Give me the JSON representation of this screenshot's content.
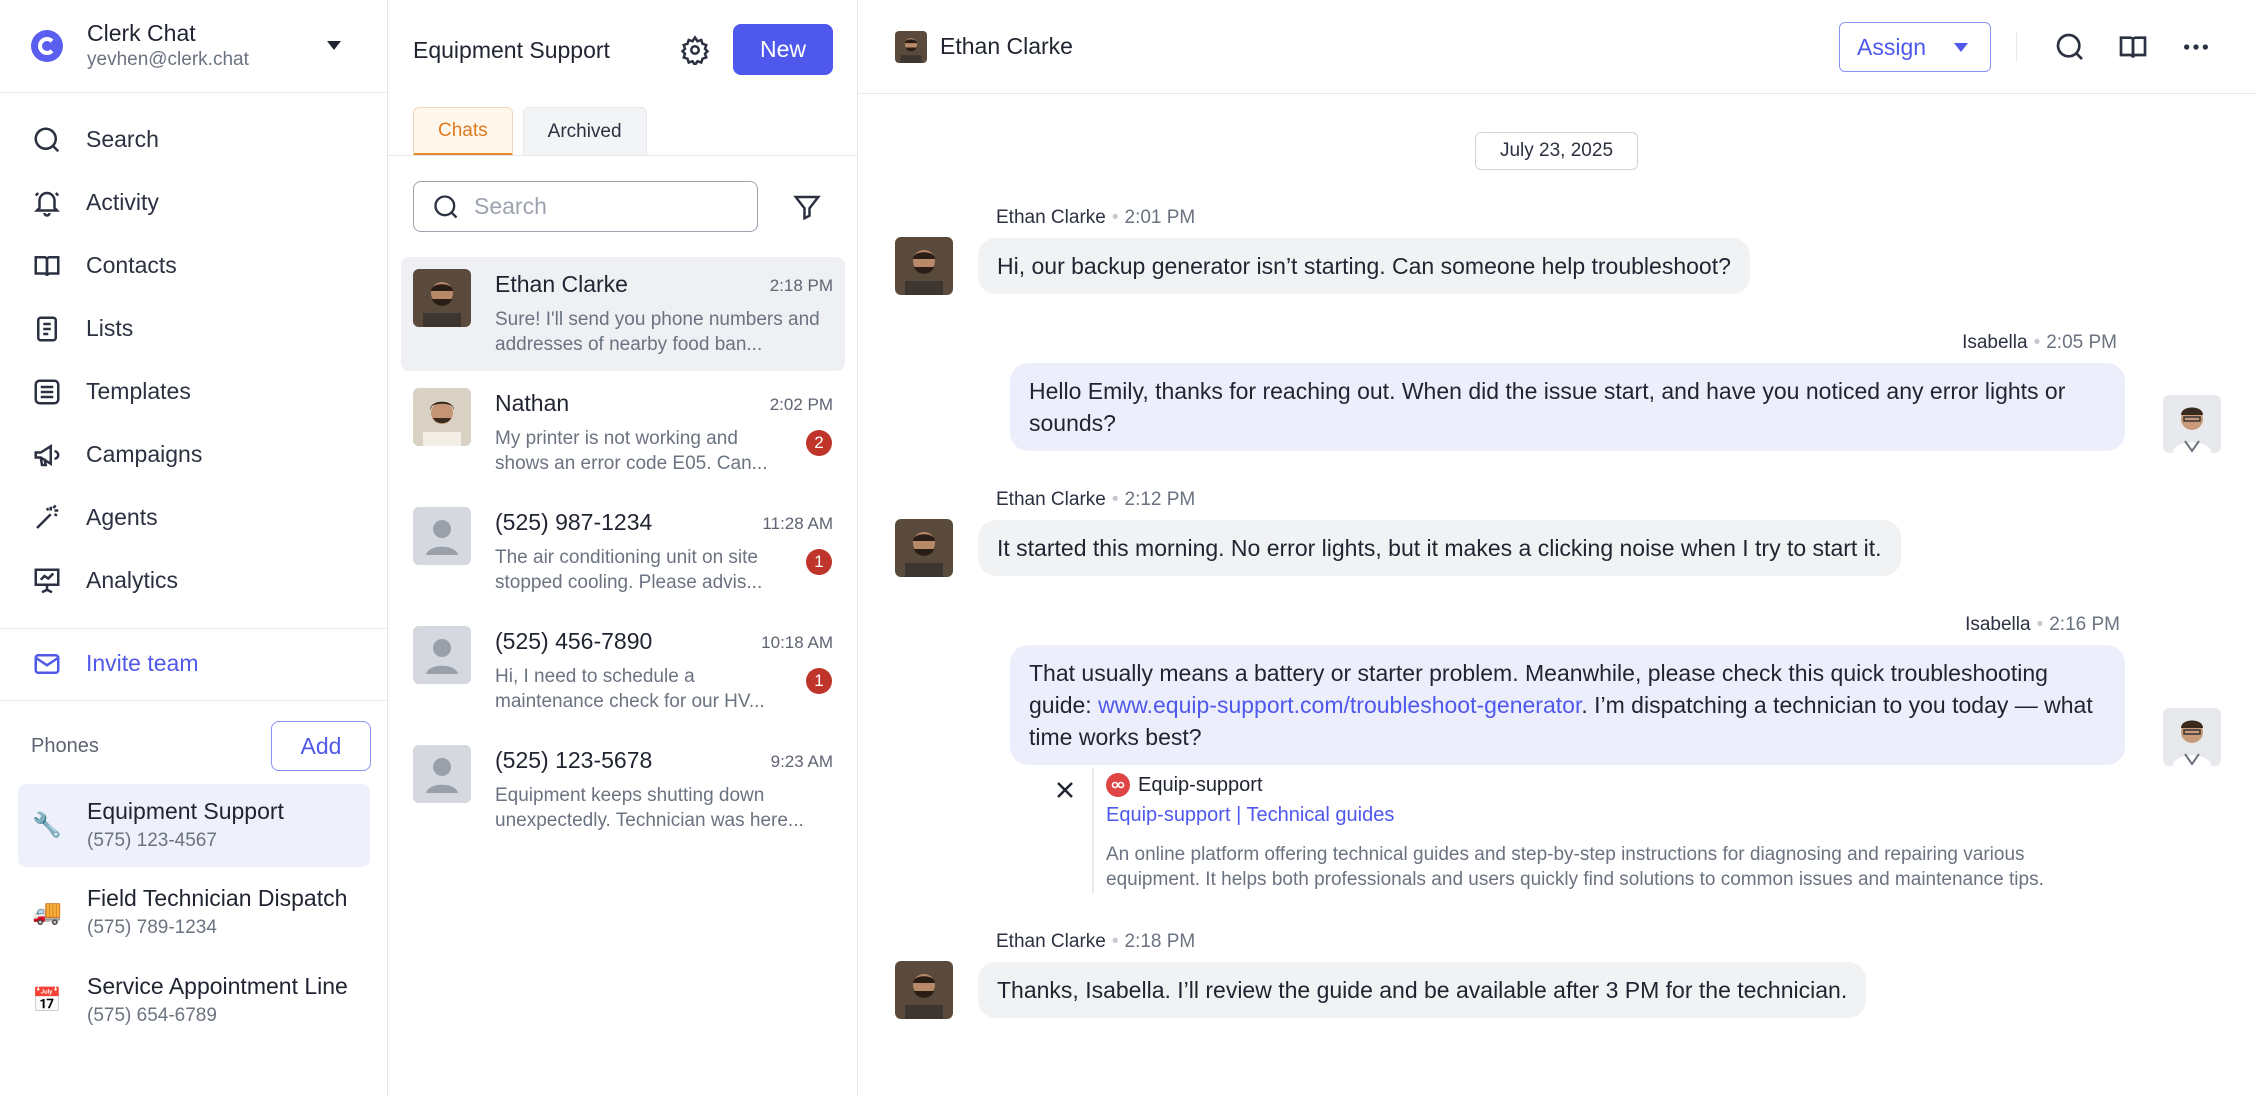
{
  "account": {
    "name": "Clerk Chat",
    "email": "yevhen@clerk.chat"
  },
  "nav": [
    {
      "label": "Search",
      "icon": "search-icon"
    },
    {
      "label": "Activity",
      "icon": "bell-icon"
    },
    {
      "label": "Contacts",
      "icon": "book-icon"
    },
    {
      "label": "Lists",
      "icon": "list-icon"
    },
    {
      "label": "Templates",
      "icon": "templates-icon"
    },
    {
      "label": "Campaigns",
      "icon": "megaphone-icon"
    },
    {
      "label": "Agents",
      "icon": "wand-icon"
    },
    {
      "label": "Analytics",
      "icon": "presentation-icon"
    }
  ],
  "invite": {
    "label": "Invite team",
    "icon": "mail-icon"
  },
  "phones": {
    "title": "Phones",
    "add_label": "Add",
    "items": [
      {
        "emoji": "🔧",
        "name": "Equipment Support",
        "number": "(575) 123-4567"
      },
      {
        "emoji": "🚚",
        "name": "Field Technician Dispatch",
        "number": "(575) 789-1234"
      },
      {
        "emoji": "📅",
        "name": "Service Appointment Line",
        "number": "(575) 654-6789"
      }
    ]
  },
  "list_panel": {
    "title": "Equipment Support",
    "new_label": "New",
    "tabs": [
      {
        "label": "Chats"
      },
      {
        "label": "Archived"
      }
    ],
    "search_placeholder": "Search",
    "conversations": [
      {
        "name": "Ethan Clarke",
        "time": "2:18 PM",
        "preview": "Sure! I'll send you phone numbers and addresses of nearby food ban...",
        "badge": ""
      },
      {
        "name": "Nathan",
        "time": "2:02 PM",
        "preview": "My printer is not working and shows an error code E05. Can...",
        "badge": "2"
      },
      {
        "name": "(525) 987-1234",
        "time": "11:28 AM",
        "preview": "The air conditioning unit on site stopped cooling. Please advis...",
        "badge": "1"
      },
      {
        "name": "(525) 456-7890",
        "time": "10:18 AM",
        "preview": "Hi, I need to schedule a maintenance check for our HV...",
        "badge": "1"
      },
      {
        "name": "(525) 123-5678",
        "time": "9:23 AM",
        "preview": "Equipment keeps shutting down unexpectedly. Technician was here...",
        "badge": ""
      }
    ]
  },
  "chat": {
    "contact_name": "Ethan Clarke",
    "assign_label": "Assign",
    "date": "July 23, 2025",
    "messages": [
      {
        "sender": "Ethan Clarke",
        "time": "2:01 PM",
        "text": "Hi, our backup generator isn’t starting. Can someone help troubleshoot?"
      },
      {
        "sender": "Isabella",
        "time": "2:05 PM",
        "text": "Hello Emily, thanks for reaching out. When did the issue start, and have you noticed any error lights or sounds?"
      },
      {
        "sender": "Ethan Clarke",
        "time": "2:12 PM",
        "text": "It started this morning. No error lights, but it makes a clicking noise when I try to start it."
      },
      {
        "sender": "Isabella",
        "time": "2:16 PM",
        "text_before": "That usually means a battery or starter problem. Meanwhile, please check this quick troubleshooting guide: ",
        "link": "www.equip-support.com/troubleshoot-generator",
        "text_after": ". I’m dispatching a technician to you today — what time works best?"
      },
      {
        "sender": "Ethan Clarke",
        "time": "2:18 PM",
        "text": "Thanks, Isabella. I’ll review the guide and be available after 3 PM for the technician."
      }
    ],
    "link_preview": {
      "site": "Equip-support",
      "links": "Equip-support | Technical guides",
      "description": "An online platform offering technical guides and step-by-step instructions for diagnosing and repairing various equipment. It helps both professionals and users quickly find solutions to common issues and maintenance tips."
    }
  },
  "colors": {
    "accent": "#4f58ec",
    "badge": "#c0352b",
    "tab_active": "#e07b1f"
  }
}
